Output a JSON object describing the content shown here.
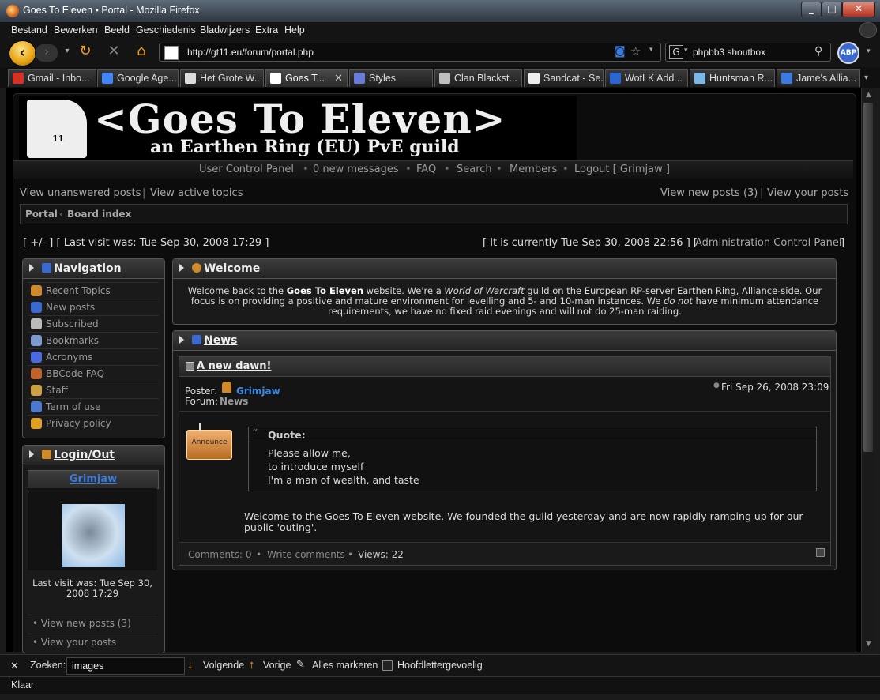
{
  "window": {
    "title": "Goes To Eleven • Portal - Mozilla Firefox",
    "buttons": [
      "_",
      "□",
      "✕"
    ]
  },
  "menu": [
    "Bestand",
    "Bewerken",
    "Beeld",
    "Geschiedenis",
    "Bladwijzers",
    "Extra",
    "Help"
  ],
  "toolbar": {
    "url": "http://gt11.eu/forum/portal.php",
    "search_value": "phpbb3 shoutbox",
    "abp_label": "ABP"
  },
  "tabs": [
    {
      "label": "Gmail - Inbo...",
      "color": "#d93025"
    },
    {
      "label": "Google Age...",
      "color": "#4285f4"
    },
    {
      "label": "Het Grote W...",
      "color": "#dddddd"
    },
    {
      "label": "Goes T...",
      "color": "#ffffff",
      "active": true
    },
    {
      "label": "Styles",
      "color": "#6a7bd6"
    },
    {
      "label": "Clan Blackst...",
      "color": "#c0c0c0"
    },
    {
      "label": "Sandcat - Se...",
      "color": "#eeeeee"
    },
    {
      "label": "WotLK Add...",
      "color": "#2a66d1"
    },
    {
      "label": "Huntsman R...",
      "color": "#7ab8e8"
    },
    {
      "label": "Jame's Allia...",
      "color": "#3b7be0"
    }
  ],
  "site": {
    "banner_title": "<Goes To Eleven>",
    "banner_subtitle": "an Earthen Ring (EU) PvE guild",
    "banner_leaf_number": "11",
    "topnav": [
      "User Control Panel",
      "•",
      "0 new messages",
      "•",
      "FAQ",
      "•",
      "Search",
      "•",
      "Members",
      "•",
      "Logout [ Grimjaw ]"
    ],
    "left_links": [
      "View unanswered posts",
      "|",
      "View active topics"
    ],
    "right_links": [
      "View new posts (3)",
      "|",
      "View your posts"
    ],
    "breadcrumb": [
      "Portal",
      "‹",
      "Board index"
    ],
    "last_visit": "[ +/- ] [ Last visit was: Tue Sep 30, 2008 17:29 ]",
    "current_time": "[ It is currently Tue Sep 30, 2008 22:56 ] [",
    "acp_link": "Administration Control Panel",
    "acp_close": "]"
  },
  "navigation": {
    "title": "Navigation",
    "items": [
      {
        "label": "Recent Topics",
        "color": "#d08a2a"
      },
      {
        "label": "New posts",
        "color": "#3a6ad0"
      },
      {
        "label": "Subscribed",
        "color": "#bbbbbb"
      },
      {
        "label": "Bookmarks",
        "color": "#7a9ad0"
      },
      {
        "label": "Acronyms",
        "color": "#4a6ae0"
      },
      {
        "label": "BBCode FAQ",
        "color": "#c0622a"
      },
      {
        "label": "Staff",
        "color": "#caa040"
      },
      {
        "label": "Term of use",
        "color": "#4a7ad0"
      },
      {
        "label": "Privacy policy",
        "color": "#e0a020"
      }
    ]
  },
  "login": {
    "title": "Login/Out",
    "username": "Grimjaw",
    "last_visit": "Last visit was: Tue Sep 30, 2008 17:29",
    "links": [
      "• View new posts (3)",
      "• View your posts"
    ]
  },
  "welcome": {
    "title": "Welcome",
    "text_1": "Welcome back to the ",
    "site_name": "Goes To Eleven",
    "text_2": " website. We're a ",
    "game": "World of Warcraft",
    "text_3": " guild on the European RP-server Earthen Ring, Alliance-side. Our focus is on providing a positive and mature environment for levelling and 5- and 10-man instances. We ",
    "emphasis": "do not",
    "text_4": " have minimum attendance requirements, we have no fixed raid evenings and will not do 25-man raiding."
  },
  "news": {
    "title": "News",
    "post_title": "A new dawn!",
    "poster_label": "Poster:",
    "poster": "Grimjaw",
    "forum_label": "Forum:",
    "forum": "News",
    "date": "Fri Sep 26, 2008 23:09",
    "badge": "Announce",
    "quote_label": "Quote:",
    "quote_lines": [
      "Please allow me,",
      "to introduce myself",
      "I'm a man of wealth, and taste"
    ],
    "body": "Welcome to the Goes To Eleven website. We founded the guild yesterday and are now rapidly ramping up for our public 'outing'.",
    "footer": [
      "Comments: 0",
      "•",
      "Write comments",
      "•",
      "Views: 22"
    ]
  },
  "findbar": {
    "close": "✕",
    "label": "Zoeken:",
    "value": "images",
    "next": "Volgende",
    "prev": "Vorige",
    "highlight": "Alles markeren",
    "match_case": "Hoofdlettergevoelig"
  },
  "status": {
    "text": "Klaar"
  }
}
